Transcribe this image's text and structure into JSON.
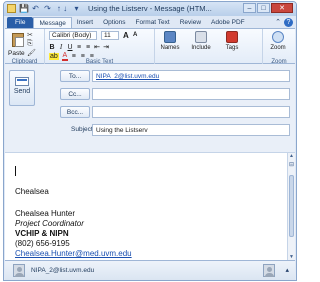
{
  "window": {
    "title": "Using the Listserv - Message (HTM...",
    "controls": {
      "minimize": "–",
      "maximize": "□",
      "close": "✕"
    }
  },
  "qat": {
    "save": "💾",
    "undo": "↶",
    "redo": "↷",
    "arrows": "↑ ↓",
    "more": "▾"
  },
  "ribbon": {
    "tabs": [
      "File",
      "Message",
      "Insert",
      "Options",
      "Format Text",
      "Review",
      "Adobe PDF"
    ],
    "active_tab": "Message",
    "clipboard": {
      "paste": "Paste",
      "group": "Clipboard"
    },
    "basic_text": {
      "font": "Calibri (Body)",
      "size": "11",
      "grow": "A",
      "shrink": "A",
      "bold": "B",
      "italic": "I",
      "underline": "U",
      "bullets": "≡",
      "numbering": "≡",
      "decrease_indent": "⇤",
      "increase_indent": "⇥",
      "highlight": "ab",
      "font_color": "A",
      "align_left": "≡",
      "center": "≡",
      "align_right": "≡",
      "group": "Basic Text"
    },
    "names": {
      "names": "Names",
      "include": "Include",
      "tags": "Tags"
    },
    "zoom": {
      "zoom": "Zoom",
      "group": "Zoom"
    }
  },
  "compose": {
    "send": "Send",
    "to_label": "To...",
    "to_value": "NIPA_2@list.uvm.edu",
    "cc_label": "Cc...",
    "cc_value": "",
    "bcc_label": "Bcc...",
    "bcc_value": "",
    "subject_label": "Subject:",
    "subject_value": "Using the Listserv"
  },
  "body": {
    "greeting": "Chealsea",
    "signature": {
      "name": "Chealsea Hunter",
      "title": "Project Coordinator",
      "org": "VCHIP & NIPN",
      "phone": "(802) 656-9195",
      "email": "Chealsea.Hunter@med.uvm.edu"
    }
  },
  "people_pane": {
    "contact": "NIPA_2@list.uvm.edu",
    "collapse": "▴"
  },
  "colors": {
    "file_tab": "#2a5ea8",
    "accent": "#1a4fb0",
    "ribbon_border": "#9fb6d6"
  }
}
